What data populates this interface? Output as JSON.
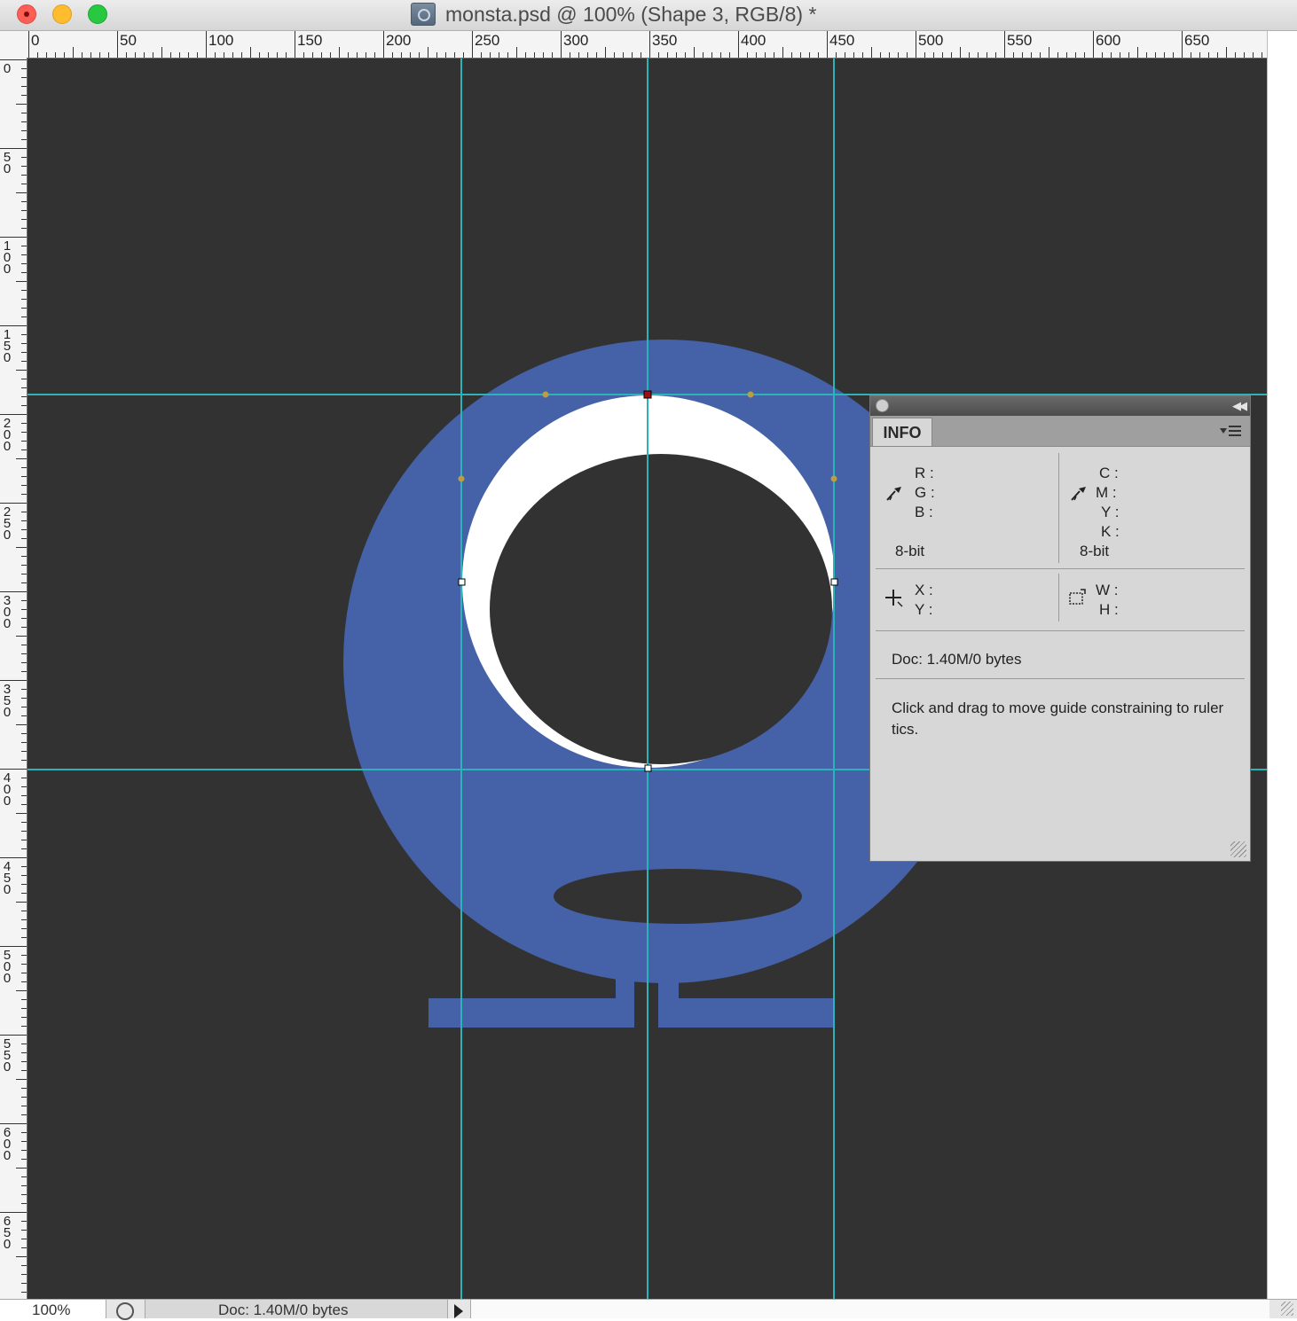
{
  "window": {
    "title": "monsta.psd @ 100% (Shape 3, RGB/8) *"
  },
  "rulers": {
    "top_labels": [
      "0",
      "50",
      "100",
      "150",
      "200",
      "250",
      "300",
      "350",
      "400",
      "450",
      "500",
      "550",
      "600",
      "650"
    ],
    "left_labels": [
      "0",
      "50",
      "100",
      "150",
      "200",
      "250",
      "300",
      "350",
      "400",
      "450",
      "500",
      "550",
      "600",
      "650"
    ]
  },
  "colors": {
    "canvas_bg": "#323232",
    "shape_blue": "#4562a8",
    "guide": "#2bb3b8",
    "white": "#ffffff"
  },
  "info_panel": {
    "tab_label": "INFO",
    "rgb_labels": [
      "R :",
      "G :",
      "B :"
    ],
    "cmyk_labels": [
      "C :",
      "M :",
      "Y :",
      "K :"
    ],
    "left_bitdepth": "8-bit",
    "right_bitdepth": "8-bit",
    "xy_labels": [
      "X :",
      "Y :"
    ],
    "wh_labels": [
      "W :",
      "H :"
    ],
    "doc_info": "Doc: 1.40M/0 bytes",
    "help_text": "Click and drag to move guide constraining to ruler tics."
  },
  "status_bar": {
    "zoom": "100%",
    "doc_info": "Doc: 1.40M/0 bytes"
  },
  "icons": {
    "eyedropper": "eyedropper-icon",
    "crosshair": "crosshair-icon",
    "selection": "selection-size-icon",
    "panel_menu": "panel-menu-icon"
  }
}
